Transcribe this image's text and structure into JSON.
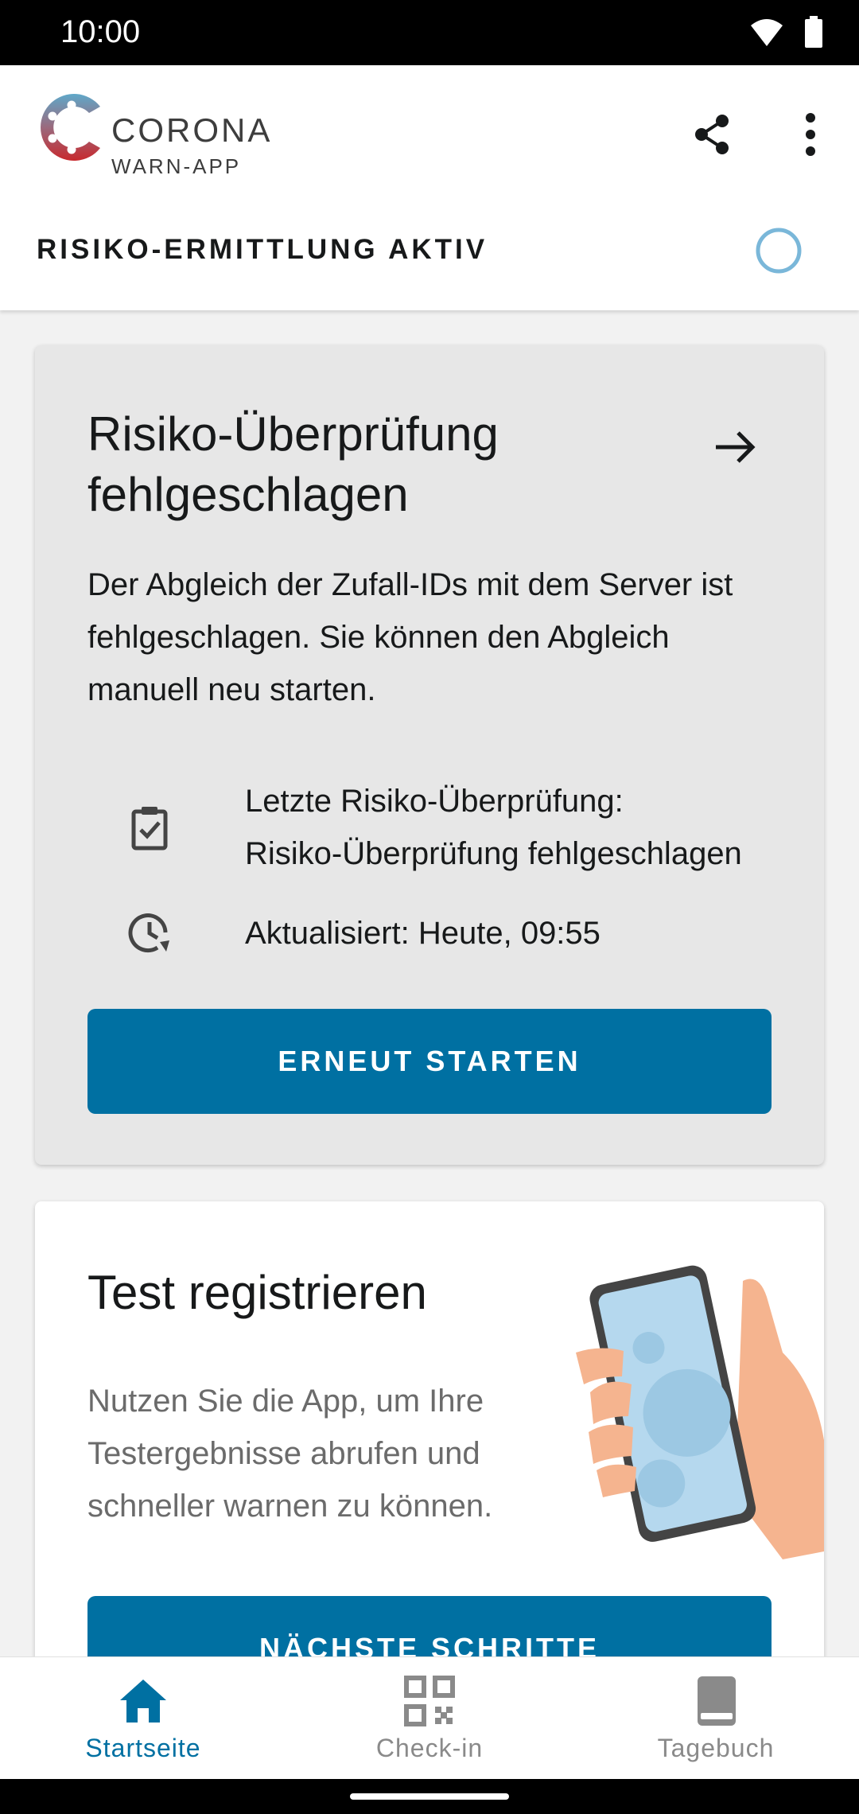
{
  "status_bar": {
    "time": "10:00"
  },
  "app": {
    "logo_line1": "CORONA",
    "logo_line2": "WARN-APP"
  },
  "risk_bar": {
    "label": "RISIKO-ERMITTLUNG AKTIV"
  },
  "failed_card": {
    "title": "Risiko-Überprüfung fehlgeschlagen",
    "body": "Der Abgleich der Zufall-IDs mit dem Server ist fehlgeschlagen. Sie können den Abgleich manuell neu starten.",
    "last_check_label": "Letzte Risiko-Überprüfung:",
    "last_check_value": "Risiko-Überprüfung fehlgeschlagen",
    "updated": "Aktualisiert: Heute, 09:55",
    "button": "ERNEUT STARTEN"
  },
  "test_card": {
    "title": "Test registrieren",
    "body": "Nutzen Sie die App, um Ihre Testergebnisse abrufen und schneller warnen zu können.",
    "button": "NÄCHSTE SCHRITTE"
  },
  "bottom_nav": [
    {
      "label": "Startseite",
      "icon": "home-icon",
      "active": true
    },
    {
      "label": "Check-in",
      "icon": "qr-code-icon",
      "active": false
    },
    {
      "label": "Tagebuch",
      "icon": "book-icon",
      "active": false
    }
  ],
  "colors": {
    "accent": "#0070a2",
    "card_failed_bg": "#e7e7e7",
    "nav_active": "#0070a2",
    "nav_inactive": "#8a8a8a",
    "risk_indicator": "#7ab7d9"
  }
}
